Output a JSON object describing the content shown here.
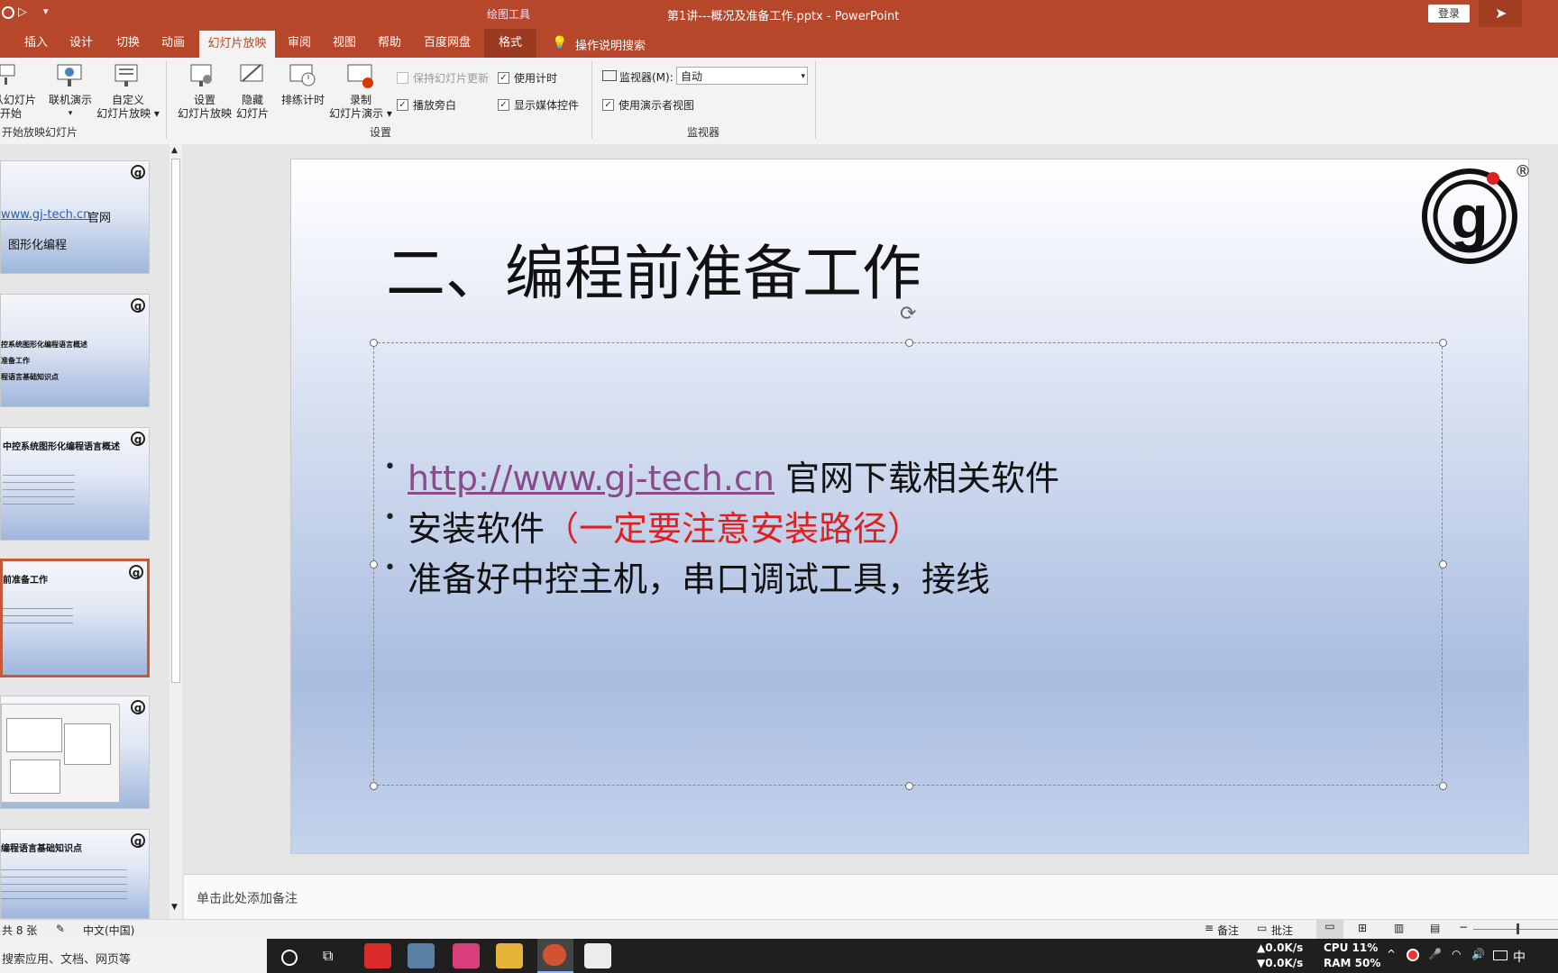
{
  "window": {
    "title": "第1讲---概况及准备工作.pptx  -  PowerPoint",
    "drawing_tools": "绘图工具",
    "login": "登录",
    "colors": {
      "accent": "#b7472a",
      "selected": "#c55a3a"
    }
  },
  "tabs": [
    "插入",
    "设计",
    "切换",
    "动画",
    "幻灯片放映",
    "审阅",
    "视图",
    "帮助",
    "百度网盘",
    "格式"
  ],
  "search_hint": "操作说明搜索",
  "ribbon": {
    "from_current_line1": "从幻灯片",
    "from_current_line2": "开始",
    "online": "联机演示",
    "custom_line1": "自定义",
    "custom_line2": "幻灯片放映",
    "setup_line1": "设置",
    "setup_line2": "幻灯片放映",
    "hide_line1": "隐藏",
    "hide_line2": "幻灯片",
    "rehearse": "排练计时",
    "record_line1": "录制",
    "record_line2": "幻灯片演示",
    "group_start": "开始放映幻灯片",
    "group_setup": "设置",
    "group_monitor": "监视器",
    "keep_updated": "保持幻灯片更新",
    "use_timing": "使用计时",
    "play_narration": "播放旁白",
    "show_media": "显示媒体控件",
    "monitor_label": "监视器(M):",
    "monitor_value": "自动",
    "presenter_view": "使用演示者视图"
  },
  "thumbnails": {
    "t1_link": "www.gj-tech.cn",
    "t1_official": "官网",
    "t1_graphic": "图形化编程",
    "t2_line1": "控系统图形化编程语言概述",
    "t2_line2": "准备工作",
    "t2_line3": "程语言基础知识点",
    "t3_title": "中控系统图形化编程语言概述",
    "t4_title": "前准备工作",
    "t6_title": "编程语言基础知识点"
  },
  "slide": {
    "title": "二、编程前准备工作",
    "bullet1_link": "http://www.gj-tech.cn",
    "bullet1_text": " 官网下载相关软件",
    "bullet2_text": "安装软件",
    "bullet2_red": "（一定要注意安装路径）",
    "bullet3_text": "准备好中控主机，串口调试工具，接线",
    "logo_mark": "®"
  },
  "notes_placeholder": "单击此处添加备注",
  "status": {
    "slide_count": "共 8 张",
    "language": "中文(中国)",
    "notes": "备注",
    "comments": "批注"
  },
  "taskbar": {
    "search": "搜索应用、文档、网页等",
    "net_up": "▲0.0K/s",
    "net_down": "▼0.0K/s",
    "cpu": "CPU  11%",
    "ram": "RAM 50%",
    "ime": "中"
  }
}
